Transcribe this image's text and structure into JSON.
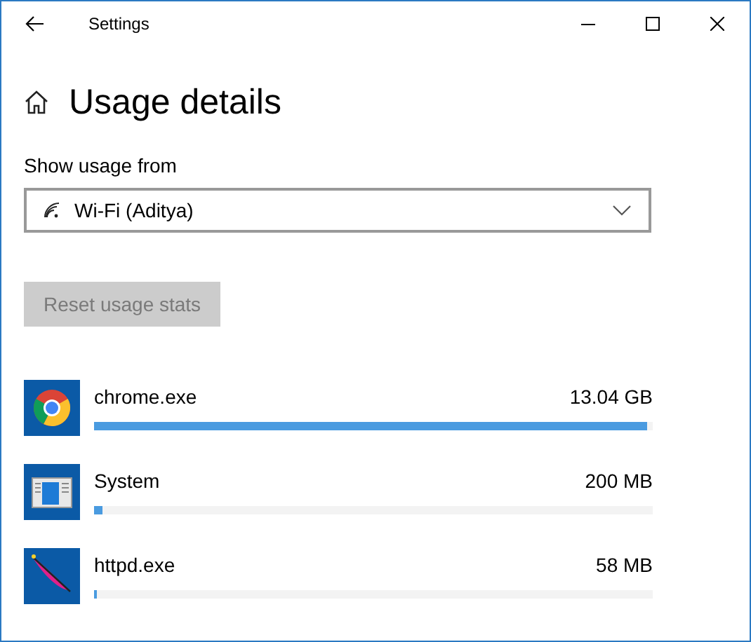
{
  "window": {
    "title": "Settings"
  },
  "page": {
    "heading": "Usage details"
  },
  "usage_source": {
    "label": "Show usage from",
    "value": "Wi-Fi (Aditya)"
  },
  "reset_button": {
    "label": "Reset usage stats",
    "disabled": true
  },
  "apps": [
    {
      "name": "chrome.exe",
      "usage": "13.04 GB",
      "level": 0.99,
      "kind": "chrome"
    },
    {
      "name": "System",
      "usage": "200 MB",
      "level": 0.015,
      "kind": "system"
    },
    {
      "name": "httpd.exe",
      "usage": "58 MB",
      "level": 0.005,
      "kind": "feather"
    }
  ]
}
